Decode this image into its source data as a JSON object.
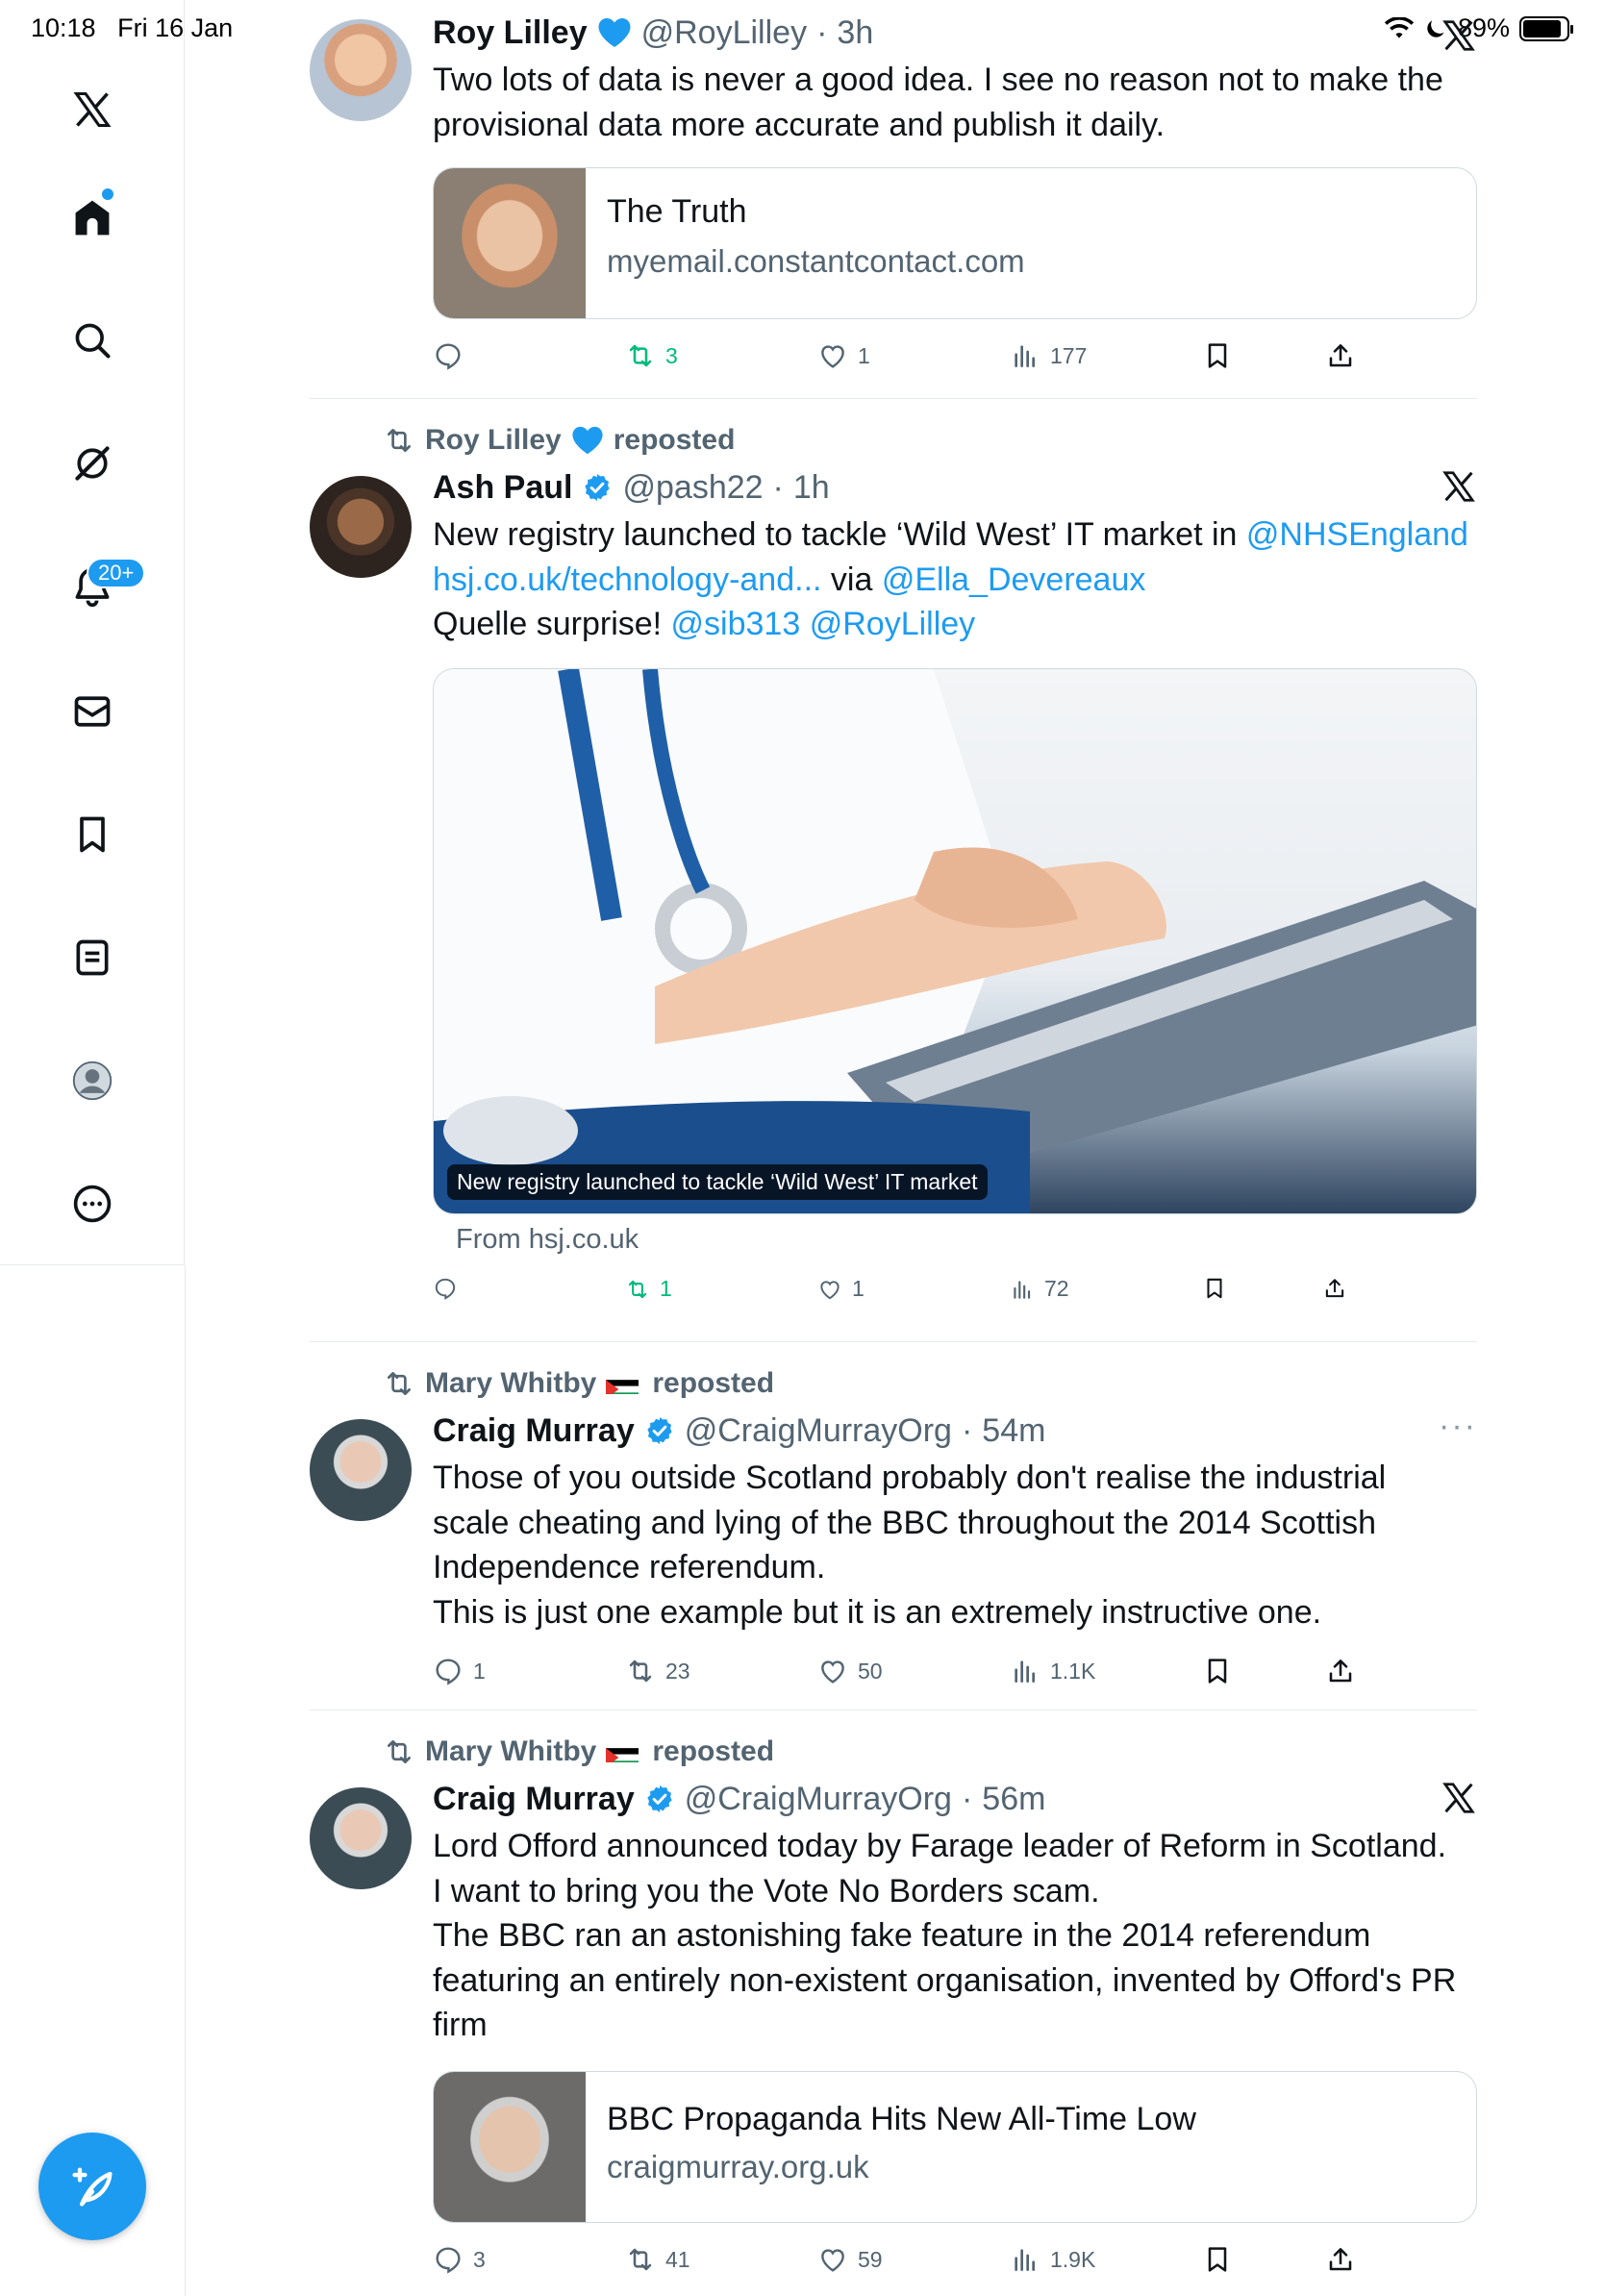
{
  "status_bar": {
    "time": "10:18",
    "date": "Fri 16 Jan",
    "battery": "89%"
  },
  "sidebar": {
    "items": [
      {
        "name": "x-logo",
        "icon": "x-logo-icon"
      },
      {
        "name": "home",
        "icon": "home-icon"
      },
      {
        "name": "explore",
        "icon": "search-icon"
      },
      {
        "name": "grok",
        "icon": "grok-icon"
      },
      {
        "name": "notifications",
        "icon": "bell-icon",
        "badge": "20+"
      },
      {
        "name": "messages",
        "icon": "mail-icon"
      },
      {
        "name": "bookmarks",
        "icon": "bookmark-icon"
      },
      {
        "name": "lists",
        "icon": "list-icon"
      },
      {
        "name": "profile",
        "icon": "profile-icon"
      },
      {
        "name": "more",
        "icon": "more-circle-icon"
      }
    ]
  },
  "colors": {
    "accent": "#1d9bf0",
    "text": "#0f1419",
    "muted": "#536471",
    "green": "#00ba7c",
    "border": "#cfd9de"
  },
  "tweets": [
    {
      "name": "Roy Lilley",
      "handle": "@RoyLilley",
      "time": "3h",
      "text": "Two lots of data is never a good idea. I see no reason not to make the provisional data more accurate and publish it daily.",
      "card": {
        "title": "The Truth",
        "domain": "myemail.constantcontact.com"
      },
      "actions": {
        "replies": "",
        "reposts": "3",
        "likes": "1",
        "views": "177"
      }
    },
    {
      "repost_by": "Roy Lilley",
      "repost_label": "reposted",
      "name": "Ash Paul",
      "handle": "@pash22",
      "time": "1h",
      "text_line1": "New registry launched to tackle ‘Wild West’ IT market in ",
      "mention1": "@NHSEngland",
      "link": "hsj.co.uk/technology-and...",
      "via": " via ",
      "mention2": "@Ella_Devereaux",
      "text_line3": "Quelle surprise! ",
      "mention3": "@sib313",
      "mention4": "@RoyLilley",
      "media_caption": "New registry launched to tackle ‘Wild West’ IT market",
      "media_from": "From hsj.co.uk",
      "actions": {
        "replies": "",
        "reposts": "1",
        "likes": "1",
        "views": "72"
      }
    },
    {
      "repost_by": "Mary Whitby",
      "repost_label": "reposted",
      "name": "Craig Murray",
      "handle": "@CraigMurrayOrg",
      "time": "54m",
      "lines": [
        "Those of you outside Scotland probably don't realise the industrial",
        "scale cheating and lying of the BBC throughout the 2014 Scottish",
        "Independence referendum.",
        "This is just one example but it is an extremely instructive one."
      ],
      "actions": {
        "replies": "1",
        "reposts": "23",
        "likes": "50",
        "views": "1.1K"
      }
    },
    {
      "repost_by": "Mary Whitby",
      "repost_label": "reposted",
      "name": "Craig Murray",
      "handle": "@CraigMurrayOrg",
      "time": "56m",
      "lines": [
        "Lord Offord announced today by Farage leader of Reform in Scotland.",
        "I want to bring you the Vote No Borders scam.",
        "The BBC ran an astonishing fake feature in the 2014 referendum",
        "featuring an entirely non-existent organisation, invented by Offord's PR",
        "firm"
      ],
      "card": {
        "title": "BBC Propaganda Hits New All-Time Low",
        "domain": "craigmurray.org.uk"
      },
      "actions": {
        "replies": "3",
        "reposts": "41",
        "likes": "59",
        "views": "1.9K"
      }
    }
  ]
}
